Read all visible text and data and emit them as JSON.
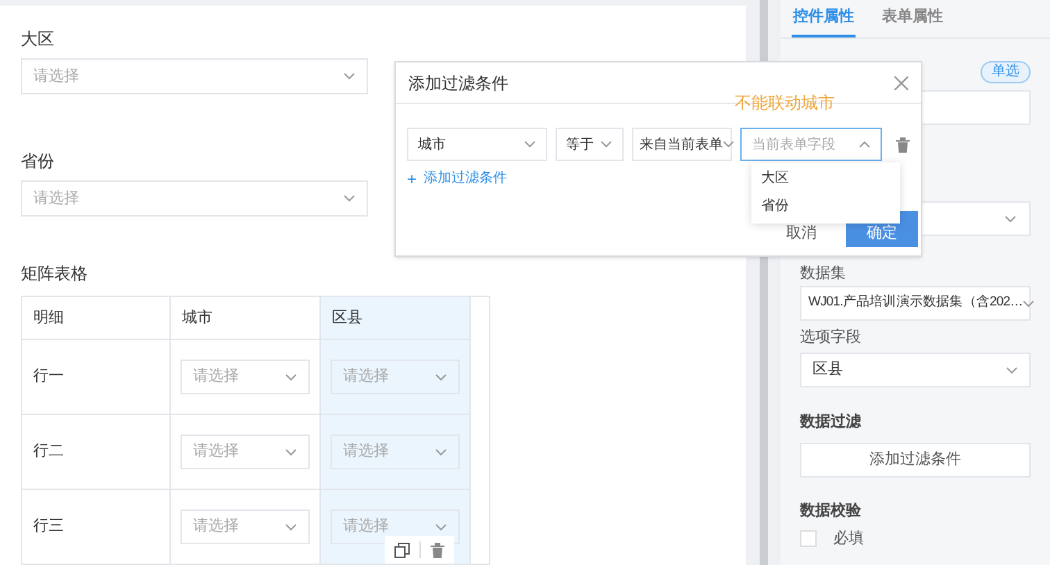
{
  "form": {
    "fields": [
      {
        "label": "大区",
        "placeholder": "请选择"
      },
      {
        "label": "省份",
        "placeholder": "请选择"
      }
    ],
    "matrix": {
      "title": "矩阵表格",
      "columns": [
        {
          "label": "明细",
          "selected": false
        },
        {
          "label": "城市",
          "selected": false
        },
        {
          "label": "区县",
          "selected": true
        }
      ],
      "rows": [
        {
          "cells": [
            "行一",
            "请选择",
            "请选择"
          ]
        },
        {
          "cells": [
            "行二",
            "请选择",
            "请选择"
          ]
        },
        {
          "cells": [
            "行三",
            "请选择",
            "请选择"
          ]
        }
      ]
    }
  },
  "panel": {
    "tabs": [
      {
        "label": "控件属性",
        "selected": true
      },
      {
        "label": "表单属性",
        "selected": false
      }
    ],
    "badge": "单选",
    "dataset_label": "数据集",
    "dataset_value": "WJ01.产品培训演示数据集（含202…",
    "option_field_label": "选项字段",
    "option_field_value": "区县",
    "filter_label": "数据过滤",
    "filter_button": "添加过滤条件",
    "validation_label": "数据校验",
    "required": {
      "label": "必填",
      "checked": false
    }
  },
  "dialog": {
    "title": "添加过滤条件",
    "note": "不能联动城市",
    "condition": {
      "field": "城市",
      "operator": "等于",
      "source": "来自当前表单",
      "target_placeholder": "当前表单字段",
      "expanded": true
    },
    "options": [
      "大区",
      "省份"
    ],
    "add_link": "添加过滤条件",
    "add_icon": "+",
    "buttons": [
      {
        "label": "取消",
        "kind": "plain"
      },
      {
        "label": "确定",
        "kind": "primary"
      }
    ]
  }
}
